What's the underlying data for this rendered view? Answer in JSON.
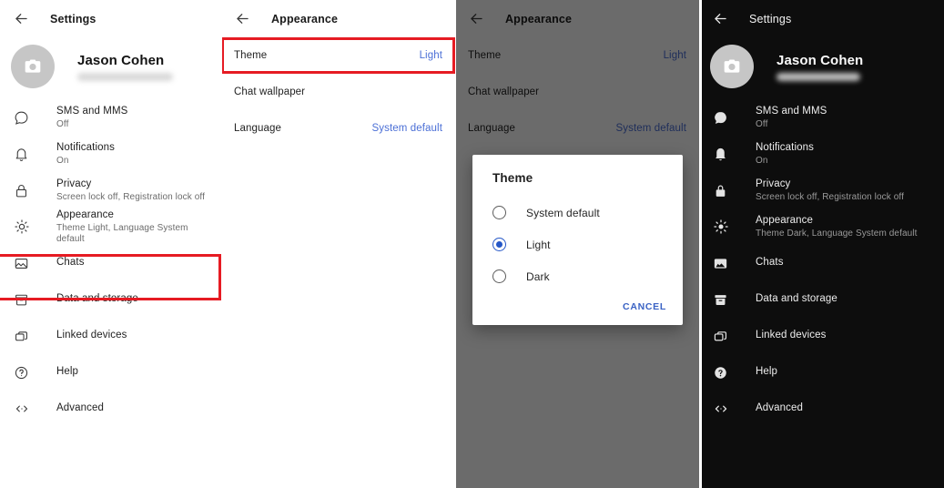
{
  "panels": {
    "settings_light": {
      "appbar": {
        "title": "Settings",
        "back_icon": "arrow-left-icon"
      },
      "profile": {
        "name": "Jason Cohen",
        "avatar_icon": "camera-icon",
        "phone_redacted": ""
      },
      "items": [
        {
          "icon": "chat-bubble-icon",
          "title": "SMS and MMS",
          "subtitle": "Off"
        },
        {
          "icon": "bell-icon",
          "title": "Notifications",
          "subtitle": "On"
        },
        {
          "icon": "lock-icon",
          "title": "Privacy",
          "subtitle": "Screen lock off, Registration lock off"
        },
        {
          "icon": "sun-icon",
          "title": "Appearance",
          "subtitle": "Theme Light, Language System default"
        },
        {
          "icon": "image-icon",
          "title": "Chats",
          "subtitle": ""
        },
        {
          "icon": "archive-box-icon",
          "title": "Data and storage",
          "subtitle": ""
        },
        {
          "icon": "linked-devices-icon",
          "title": "Linked devices",
          "subtitle": ""
        },
        {
          "icon": "help-circle-icon",
          "title": "Help",
          "subtitle": ""
        },
        {
          "icon": "code-brackets-icon",
          "title": "Advanced",
          "subtitle": ""
        }
      ]
    },
    "appearance": {
      "appbar": {
        "title": "Appearance",
        "back_icon": "arrow-left-icon"
      },
      "rows": [
        {
          "label": "Theme",
          "value": "Light"
        },
        {
          "label": "Chat wallpaper",
          "value": ""
        },
        {
          "label": "Language",
          "value": "System default"
        }
      ]
    },
    "appearance_dialog": {
      "appbar": {
        "title": "Appearance",
        "back_icon": "arrow-left-icon"
      },
      "rows": [
        {
          "label": "Theme",
          "value": "Light"
        },
        {
          "label": "Chat wallpaper",
          "value": ""
        },
        {
          "label": "Language",
          "value": "System default"
        }
      ],
      "dialog": {
        "title": "Theme",
        "options": [
          {
            "label": "System default",
            "selected": false
          },
          {
            "label": "Light",
            "selected": true
          },
          {
            "label": "Dark",
            "selected": false
          }
        ],
        "cancel_label": "CANCEL"
      }
    },
    "settings_dark": {
      "appbar": {
        "title": "Settings",
        "back_icon": "arrow-left-icon"
      },
      "profile": {
        "name": "Jason Cohen",
        "avatar_icon": "camera-icon",
        "phone_redacted": ""
      },
      "items": [
        {
          "icon": "chat-bubble-icon",
          "title": "SMS and MMS",
          "subtitle": "Off"
        },
        {
          "icon": "bell-icon",
          "title": "Notifications",
          "subtitle": "On"
        },
        {
          "icon": "lock-icon",
          "title": "Privacy",
          "subtitle": "Screen lock off, Registration lock off"
        },
        {
          "icon": "sun-icon",
          "title": "Appearance",
          "subtitle": "Theme Dark, Language System default"
        },
        {
          "icon": "image-icon",
          "title": "Chats",
          "subtitle": ""
        },
        {
          "icon": "archive-box-icon",
          "title": "Data and storage",
          "subtitle": ""
        },
        {
          "icon": "linked-devices-icon",
          "title": "Linked devices",
          "subtitle": ""
        },
        {
          "icon": "help-circle-icon",
          "title": "Help",
          "subtitle": ""
        },
        {
          "icon": "code-brackets-icon",
          "title": "Advanced",
          "subtitle": ""
        }
      ]
    }
  },
  "colors": {
    "highlight": "#e61b23",
    "accent_link": "#4b6fd6",
    "radio_selected": "#2557c7",
    "dark_background": "#0d0d0d"
  }
}
